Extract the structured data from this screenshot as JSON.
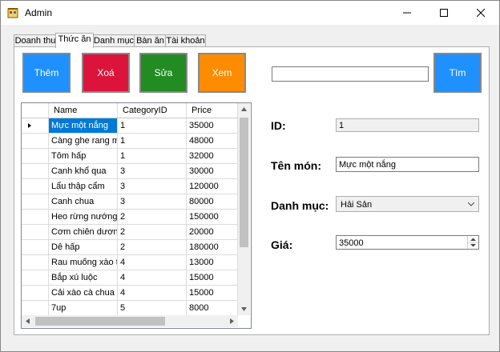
{
  "window": {
    "title": "Admin"
  },
  "tabs": [
    "Doanh thu",
    "Thức ăn",
    "Danh mục",
    "Bàn ăn",
    "Tài khoản"
  ],
  "buttons": {
    "add": "Thêm",
    "delete": "Xoá",
    "edit": "Sửa",
    "view": "Xem",
    "search": "Tìm"
  },
  "colors": {
    "add": "#1e90ff",
    "delete": "#dc143c",
    "edit": "#228b22",
    "view": "#ff8c00",
    "search": "#1e90ff",
    "selection": "#0078d7"
  },
  "search": {
    "value": ""
  },
  "grid": {
    "columns": [
      "Name",
      "CategoryID",
      "Price"
    ],
    "rows": [
      [
        "Mực một nắng",
        "1",
        "35000"
      ],
      [
        "Càng ghe rang m...",
        "1",
        "48000"
      ],
      [
        "Tôm hấp",
        "1",
        "32000"
      ],
      [
        "Canh khổ qua",
        "3",
        "30000"
      ],
      [
        "Lẩu thập cẩm",
        "3",
        "120000"
      ],
      [
        "Canh chua",
        "3",
        "80000"
      ],
      [
        "Heo rừng nướng",
        "2",
        "150000"
      ],
      [
        "Cơm chiên dương...",
        "2",
        "20000"
      ],
      [
        "Dê hấp",
        "2",
        "180000"
      ],
      [
        "Rau muống xào tỏi",
        "4",
        "13000"
      ],
      [
        "Bắp xú luộc",
        "4",
        "15000"
      ],
      [
        "Cải xào cà chua",
        "4",
        "15000"
      ],
      [
        "7up",
        "5",
        "8000"
      ]
    ],
    "selected_row": 0
  },
  "form": {
    "id_label": "ID:",
    "id_value": "1",
    "name_label": "Tên món:",
    "name_value": "Mực một nắng",
    "category_label": "Danh mục:",
    "category_value": "Hải Sản",
    "price_label": "Giá:",
    "price_value": "35000"
  }
}
